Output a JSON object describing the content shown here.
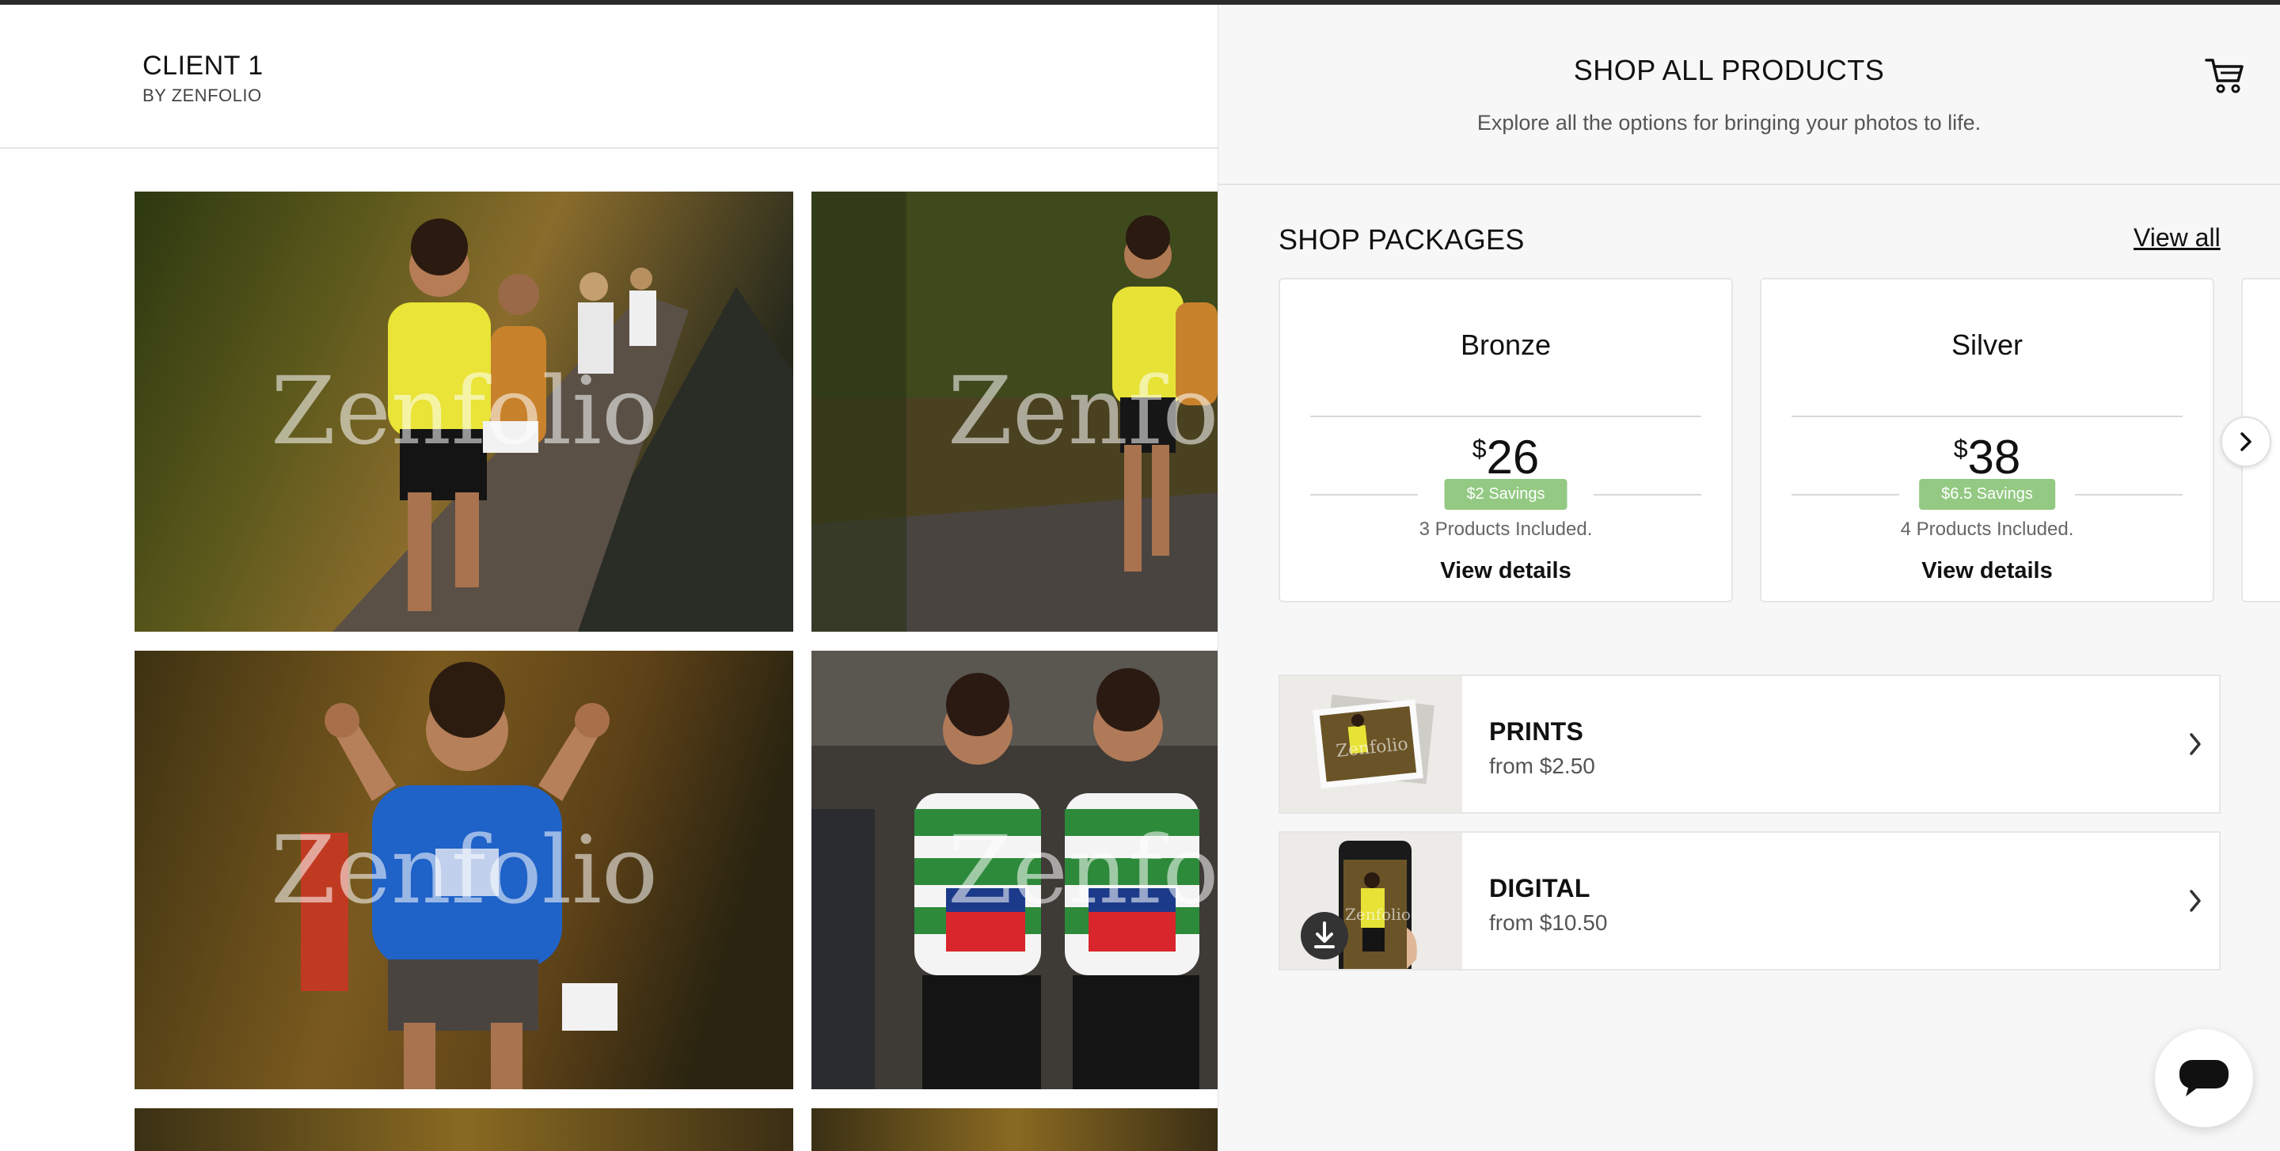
{
  "site": {
    "client_name": "CLIENT 1",
    "by_line": "BY ZENFOLIO"
  },
  "gallery": {
    "watermark": "Zenfolio",
    "photos": [
      {
        "name": "runner-yellow-shirt-65"
      },
      {
        "name": "runner-yellow-shirt-65-cropped"
      },
      {
        "name": "runner-blue-shirt"
      },
      {
        "name": "runners-green-white-jerseys"
      },
      {
        "name": "photo-row-3-left"
      },
      {
        "name": "photo-row-3-right"
      }
    ]
  },
  "shop": {
    "title": "SHOP ALL PRODUCTS",
    "subtitle": "Explore all the options for bringing your photos to life.",
    "cart_icon": "cart-icon",
    "packages": {
      "heading": "SHOP PACKAGES",
      "view_all": "View all",
      "items": [
        {
          "name": "Bronze",
          "currency": "$",
          "price": "26",
          "savings": "$2 Savings",
          "included": "3 Products Included.",
          "details": "View details"
        },
        {
          "name": "Silver",
          "currency": "$",
          "price": "38",
          "savings": "$6.5 Savings",
          "included": "4 Products Included.",
          "details": "View details"
        }
      ]
    },
    "products": [
      {
        "name": "PRINTS",
        "from": "from $2.50"
      },
      {
        "name": "DIGITAL",
        "from": "from $10.50"
      }
    ]
  },
  "colors": {
    "savings_badge": "#93c983",
    "panel_bg": "#f7f7f7"
  }
}
